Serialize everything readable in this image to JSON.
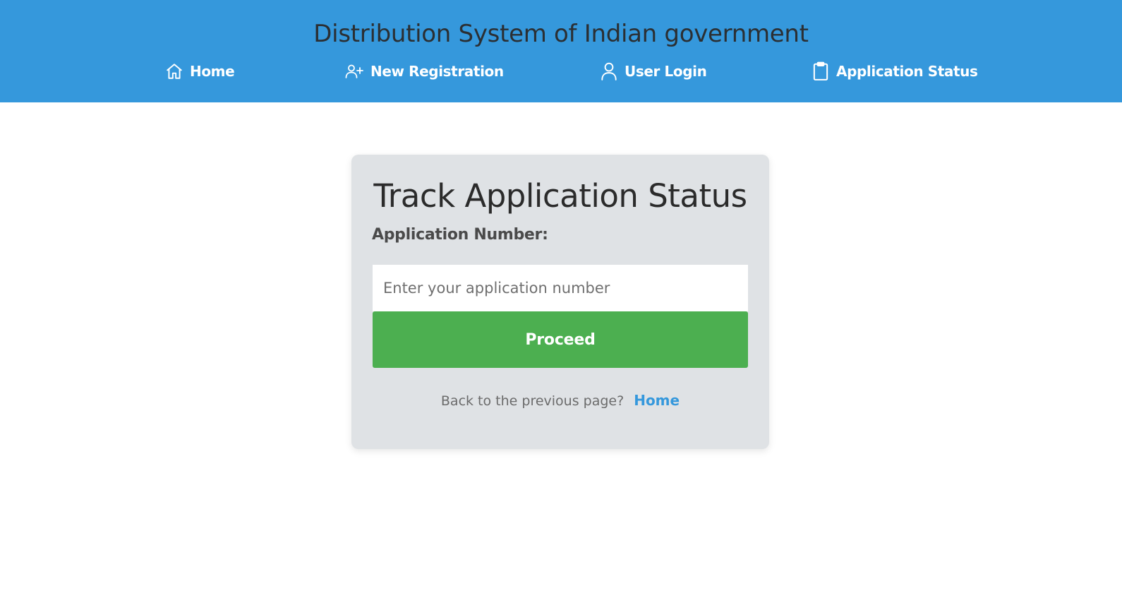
{
  "header": {
    "title": "Distribution System of Indian government",
    "bg_color": "#3598dc",
    "nav": [
      {
        "label": "Home",
        "icon": "home-icon"
      },
      {
        "label": "New Registration",
        "icon": "user-plus-icon"
      },
      {
        "label": "User Login",
        "icon": "user-icon"
      },
      {
        "label": "Application Status",
        "icon": "clipboard-icon"
      }
    ]
  },
  "card": {
    "title": "Track Application Status",
    "field_label": "Application Number:",
    "input": {
      "value": "",
      "placeholder": "Enter your application number"
    },
    "proceed_label": "Proceed",
    "proceed_color": "#4caf50",
    "back_text": "Back to the previous page?",
    "back_link_label": "Home",
    "link_color": "#3598dc"
  }
}
